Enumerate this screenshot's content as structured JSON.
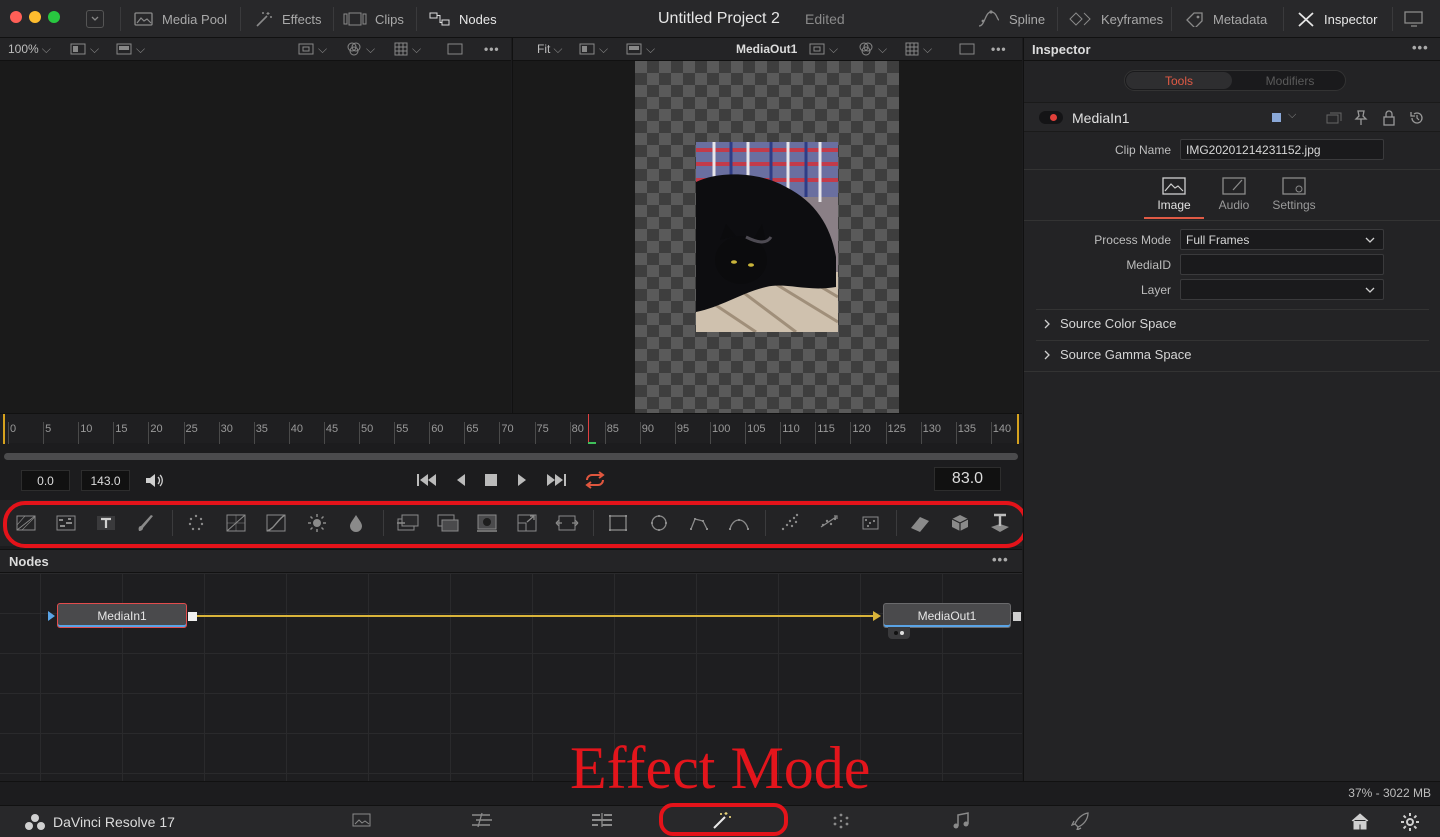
{
  "titlebar": {
    "media_pool": "Media Pool",
    "effects": "Effects",
    "clips": "Clips",
    "nodes": "Nodes",
    "project_title": "Untitled Project 2",
    "edited": "Edited",
    "spline": "Spline",
    "keyframes": "Keyframes",
    "metadata": "Metadata",
    "inspector": "Inspector"
  },
  "viewer_left": {
    "zoom": "100%"
  },
  "viewer_right": {
    "zoom": "Fit",
    "node": "MediaOut1"
  },
  "ruler": {
    "labels": [
      "0",
      "5",
      "10",
      "15",
      "20",
      "25",
      "30",
      "35",
      "40",
      "45",
      "50",
      "55",
      "60",
      "65",
      "70",
      "75",
      "80",
      "85",
      "90",
      "95",
      "100",
      "105",
      "110",
      "115",
      "120",
      "125",
      "130",
      "135",
      "140"
    ]
  },
  "transport": {
    "start": "0.0",
    "end": "143.0",
    "current": "83.0"
  },
  "nodes_panel": {
    "title": "Nodes",
    "node_in": "MediaIn1",
    "node_out": "MediaOut1"
  },
  "inspector": {
    "title": "Inspector",
    "tab_tools": "Tools",
    "tab_modifiers": "Modifiers",
    "node_name": "MediaIn1",
    "clip_name_label": "Clip Name",
    "clip_name_value": "IMG20201214231152.jpg",
    "subtab_image": "Image",
    "subtab_audio": "Audio",
    "subtab_settings": "Settings",
    "process_mode_label": "Process Mode",
    "process_mode_value": "Full Frames",
    "mediaid_label": "MediaID",
    "layer_label": "Layer",
    "source_color_space": "Source Color Space",
    "source_gamma_space": "Source Gamma Space"
  },
  "status": {
    "memory": "37% - 3022 MB"
  },
  "pagebar": {
    "app_name": "DaVinci Resolve 17"
  },
  "annotation": {
    "caption": "Effect Mode"
  },
  "colors": {
    "accent_red": "#e4131a",
    "connection": "#d9b43a",
    "active_tab": "#e05a45"
  }
}
